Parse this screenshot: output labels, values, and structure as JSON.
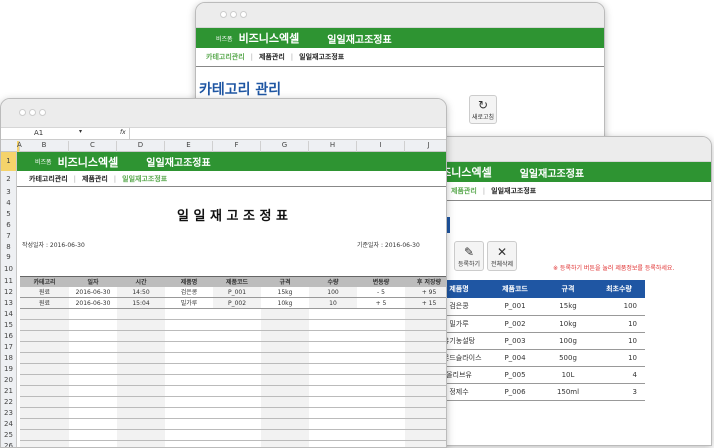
{
  "brand": {
    "small": "비즈폼",
    "name": "비즈니스엑셀",
    "title": "일일재고조정표"
  },
  "nav": [
    "카테고리관리",
    "제품관리",
    "일일재고조정표"
  ],
  "back_window": {
    "heading": "카테고리 관리",
    "refresh_label": "새로고침"
  },
  "product_window": {
    "register_label": "등록하기",
    "delete_all_label": "전체삭제",
    "note": "※ 등록하기 버튼을 눌러 제품정보를 등록하세요.",
    "columns": [
      "제품명",
      "제품코드",
      "규격",
      "최초수량"
    ],
    "rows": [
      [
        "검은콩",
        "P_001",
        "15kg",
        "100"
      ],
      [
        "밀가루",
        "P_002",
        "10kg",
        "10"
      ],
      [
        "유기농설탕",
        "P_003",
        "100g",
        "10"
      ],
      [
        "아몬드슬라이스",
        "P_004",
        "500g",
        "10"
      ],
      [
        "올리브유",
        "P_005",
        "10L",
        "4"
      ],
      [
        "정제수",
        "P_006",
        "150ml",
        "3"
      ]
    ]
  },
  "sheet": {
    "cell_ref": "A1",
    "fx": "fx",
    "col_letters": [
      "A",
      "B",
      "C",
      "D",
      "E",
      "F",
      "G",
      "H",
      "I",
      "J"
    ],
    "report_title": "일 일 재 고 조 정 표",
    "written_date": "작성일자 : 2016-06-30",
    "base_date": "기준일자 : 2016-06-30",
    "columns": [
      "카테고리",
      "일자",
      "시간",
      "제품명",
      "제품코드",
      "규격",
      "수량",
      "변동량",
      "후 저장량"
    ],
    "rows": [
      [
        "원료",
        "2016-06-30",
        "14:50",
        "검은콩",
        "P_001",
        "15kg",
        "100",
        "- 5",
        "+ 95"
      ],
      [
        "원료",
        "2016-06-30",
        "15:04",
        "밀가루",
        "P_002",
        "10kg",
        "10",
        "+ 5",
        "+ 15"
      ]
    ]
  },
  "colors": {
    "green": "#2e9432",
    "blue": "#1f56a3",
    "note_red": "#e03030"
  }
}
